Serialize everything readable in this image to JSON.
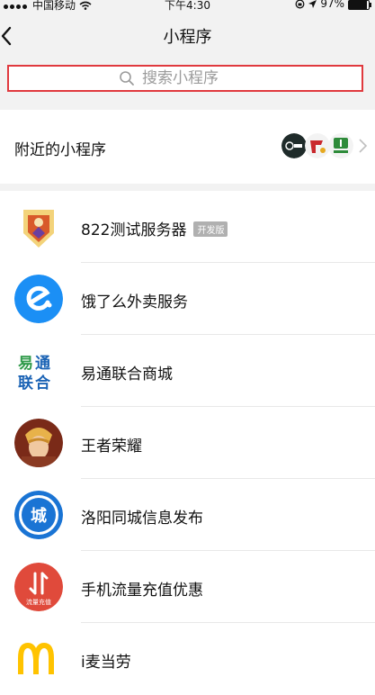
{
  "status": {
    "carrier": "中国移动",
    "time": "下午4:30",
    "battery": "97%"
  },
  "nav": {
    "title": "小程序"
  },
  "search": {
    "placeholder": "搜索小程序"
  },
  "nearby": {
    "label": "附近的小程序"
  },
  "items": [
    {
      "name": "822测试服务器",
      "badge": "开发版",
      "icon": "fantasy-hero-icon"
    },
    {
      "name": "饿了么外卖服务",
      "badge": "",
      "icon": "eleme-logo-icon"
    },
    {
      "name": "易通联合商城",
      "badge": "",
      "icon": "yitong-logo-icon"
    },
    {
      "name": "王者荣耀",
      "badge": "",
      "icon": "game-hero-avatar-icon"
    },
    {
      "name": "洛阳同城信息发布",
      "badge": "",
      "icon": "city-badge-icon"
    },
    {
      "name": "手机流量充值优惠",
      "badge": "",
      "icon": "data-topup-icon"
    },
    {
      "name": "i麦当劳",
      "badge": "",
      "icon": "mcdonalds-logo-icon"
    }
  ],
  "colors": {
    "accent": "#e0393e",
    "eleme": "#1b8ff5",
    "city": "#1a74d4",
    "topup": "#e04a3b",
    "mcd": "#ffc300"
  },
  "iconText": {
    "city": "城",
    "topup": "流量充值"
  }
}
